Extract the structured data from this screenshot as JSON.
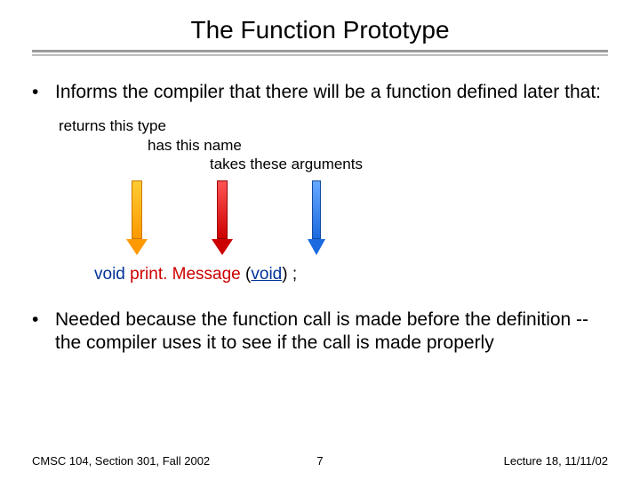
{
  "title": "The Function Prototype",
  "bullets": {
    "b1": "Informs the compiler that there will be a function defined later that:",
    "sub1": "returns this type",
    "sub2": "has this name",
    "sub3": "takes these arguments",
    "b2": "Needed because the function call is made before the definition -- the compiler uses it to see if the call is made properly"
  },
  "code": {
    "kw1": "void",
    "fn": "print. Message",
    "lparen": "(",
    "arg": "void",
    "rparen": ")",
    "semi": " ;"
  },
  "footer": {
    "left": "CMSC 104, Section 301, Fall 2002",
    "center": "7",
    "right": "Lecture 18, 11/11/02"
  }
}
